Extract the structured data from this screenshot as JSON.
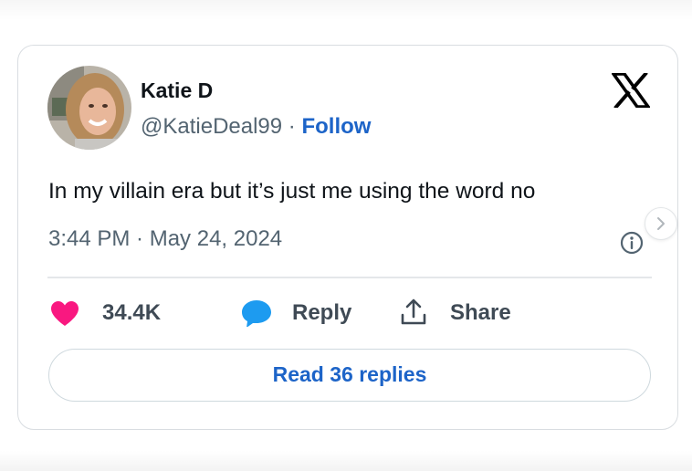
{
  "author": {
    "display_name": "Katie D",
    "handle": "@KatieDeal99",
    "separator": " · ",
    "follow_label": "Follow"
  },
  "logo": {
    "icon": "x-logo-icon"
  },
  "tweet": {
    "text": "In my villain era but it’s just me using the word no",
    "timestamp": "3:44 PM · May 24, 2024"
  },
  "actions": {
    "like_count": "34.4K",
    "reply_label": "Reply",
    "share_label": "Share"
  },
  "footer": {
    "read_replies_label": "Read 36 replies"
  },
  "colors": {
    "heart": "#f91880",
    "reply_bubble": "#1d9bf0",
    "link": "#1d64c8",
    "border": "#d9dde1"
  }
}
